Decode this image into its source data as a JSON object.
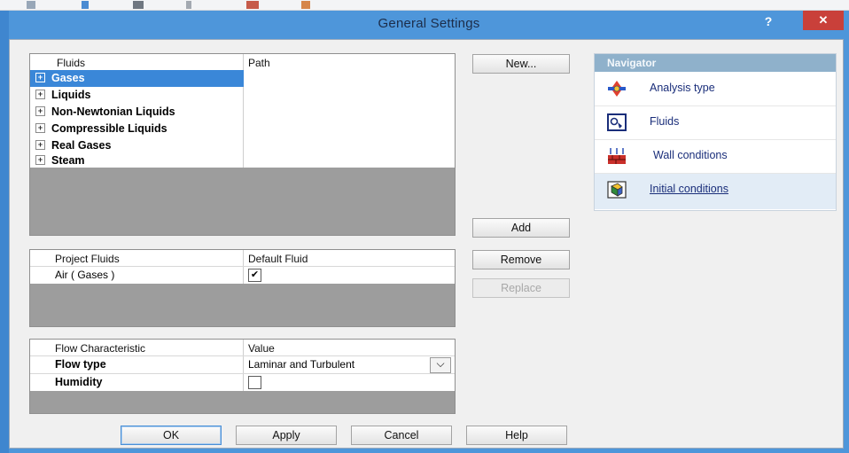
{
  "window": {
    "title": "General Settings",
    "help_glyph": "?",
    "close_glyph": "✕"
  },
  "fluids_table": {
    "headers": [
      "Fluids",
      "Path"
    ],
    "rows": [
      {
        "label": "Gases",
        "selected": true
      },
      {
        "label": "Liquids",
        "selected": false
      },
      {
        "label": "Non-Newtonian Liquids",
        "selected": false
      },
      {
        "label": "Compressible Liquids",
        "selected": false
      },
      {
        "label": "Real Gases",
        "selected": false
      },
      {
        "label": "Steam",
        "selected": false
      }
    ],
    "expander_glyph": "+"
  },
  "project_fluids": {
    "headers": [
      "Project Fluids",
      "Default Fluid"
    ],
    "rows": [
      {
        "name": "Air ( Gases )",
        "default": true
      }
    ],
    "check_glyph": "✔"
  },
  "flow_table": {
    "headers": [
      "Flow Characteristic",
      "Value"
    ],
    "rows": [
      {
        "name": "Flow type",
        "value": "Laminar and Turbulent"
      },
      {
        "name": "Humidity",
        "value": ""
      }
    ],
    "dropdown_glyph": "⌵",
    "humidity_checked": false
  },
  "buttons": {
    "new": "New...",
    "add": "Add",
    "remove": "Remove",
    "replace": "Replace",
    "ok": "OK",
    "apply": "Apply",
    "cancel": "Cancel",
    "help": "Help"
  },
  "navigator": {
    "title": "Navigator",
    "items": [
      {
        "label": "Analysis type",
        "icon": "analysis-type-icon",
        "active": false
      },
      {
        "label": "Fluids",
        "icon": "fluids-icon",
        "active": false
      },
      {
        "label": "Wall conditions",
        "icon": "wall-conditions-icon",
        "active": false
      },
      {
        "label": "Initial conditions",
        "icon": "initial-conditions-icon",
        "active": true
      }
    ]
  },
  "colors": {
    "title_bar": "#4e96da",
    "selection": "#3a87d8",
    "close_button": "#c9403a",
    "navigator_header": "#8fb1cb"
  }
}
